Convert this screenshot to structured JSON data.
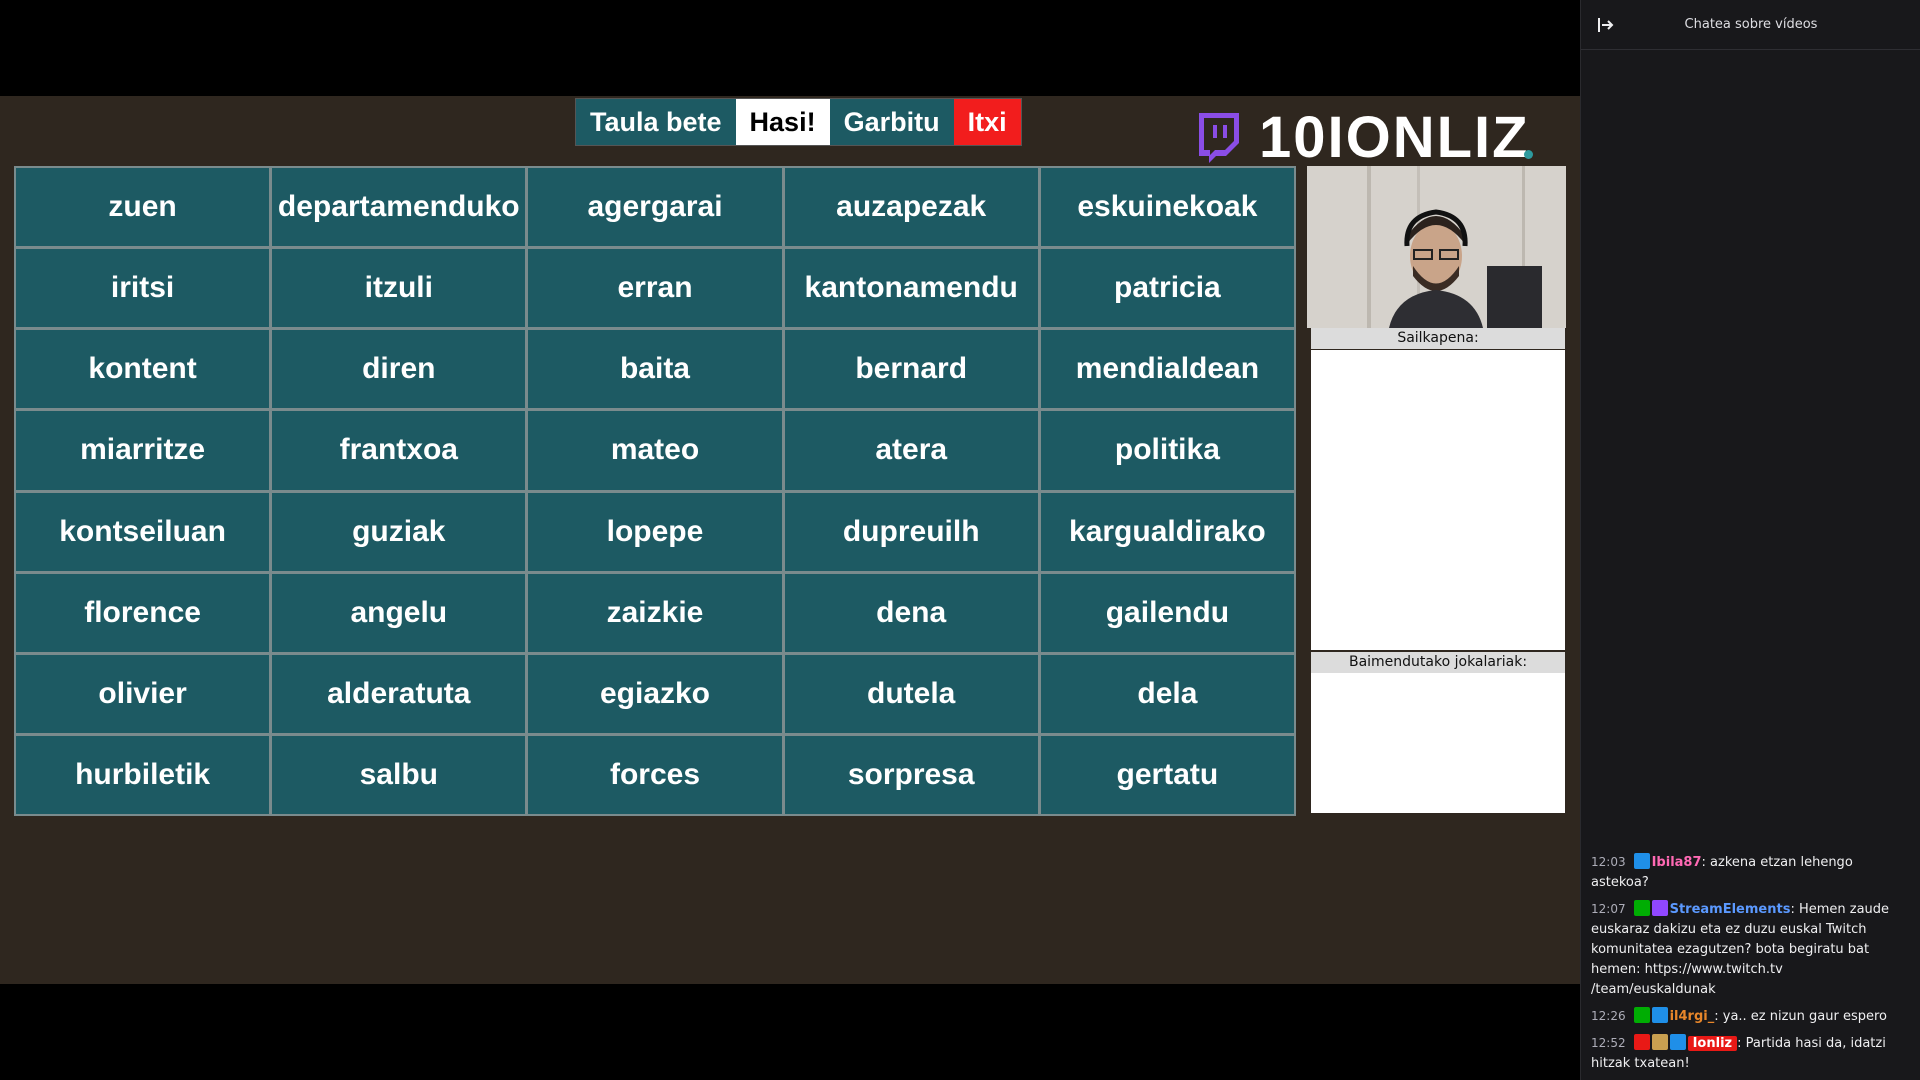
{
  "toolbar": {
    "fill_label": "Taula bete",
    "start_label": "Hasi!",
    "clear_label": "Garbitu",
    "close_label": "Itxi"
  },
  "brand": {
    "text": "10IONLIZ"
  },
  "board": {
    "rows": [
      [
        "zuen",
        "departamenduko",
        "agergarai",
        "auzapezak",
        "eskuinekoak"
      ],
      [
        "iritsi",
        "itzuli",
        "erran",
        "kantonamendu",
        "patricia"
      ],
      [
        "kontent",
        "diren",
        "baita",
        "bernard",
        "mendialdean"
      ],
      [
        "miarritze",
        "frantxoa",
        "mateo",
        "atera",
        "politika"
      ],
      [
        "kontseiluan",
        "guziak",
        "lopepe",
        "dupreuilh",
        "kargualdirako"
      ],
      [
        "florence",
        "angelu",
        "zaizkie",
        "dena",
        "gailendu"
      ],
      [
        "olivier",
        "alderatuta",
        "egiazko",
        "dutela",
        "dela"
      ],
      [
        "hurbiletik",
        "salbu",
        "forces",
        "sorpresa",
        "gertatu"
      ]
    ]
  },
  "sidebar": {
    "ranking_label": "Sailkapena:",
    "players_label": "Baimendutako jokalariak:"
  },
  "chat": {
    "title": "Chatea sobre vídeos",
    "messages": [
      {
        "time": "12:03",
        "user": "Ibila87",
        "user_color": "#ff69b4",
        "text": ": azkena etzan lehengo astekoa?",
        "badges": [
          "crown"
        ]
      },
      {
        "time": "12:07",
        "user": "StreamElements",
        "user_color": "#5b99ff",
        "text": ": Hemen zaude euskaraz dakizu eta ez duzu euskal Twitch komunitatea ezagutzen? bota begiratu bat hemen: https://www.twitch.tv /team/euskaldunak",
        "badges": [
          "mod",
          "verified"
        ]
      },
      {
        "time": "12:26",
        "user": "il4rgi_",
        "user_color": "#e8862a",
        "text": ": ya.. ez nizun gaur espero",
        "badges": [
          "mod",
          "crown"
        ]
      },
      {
        "time": "12:52",
        "user": "Ionliz",
        "user_color": "#ffffff",
        "text": ": Partida hasi da, idatzi hitzak txatean!",
        "badges": [
          "broadcaster",
          "cookie",
          "crown"
        ]
      }
    ]
  },
  "colors": {
    "cell": "#1d5a63",
    "background": "#2f271f",
    "close_button": "#f21d1d",
    "chat_bg": "#18181b"
  }
}
